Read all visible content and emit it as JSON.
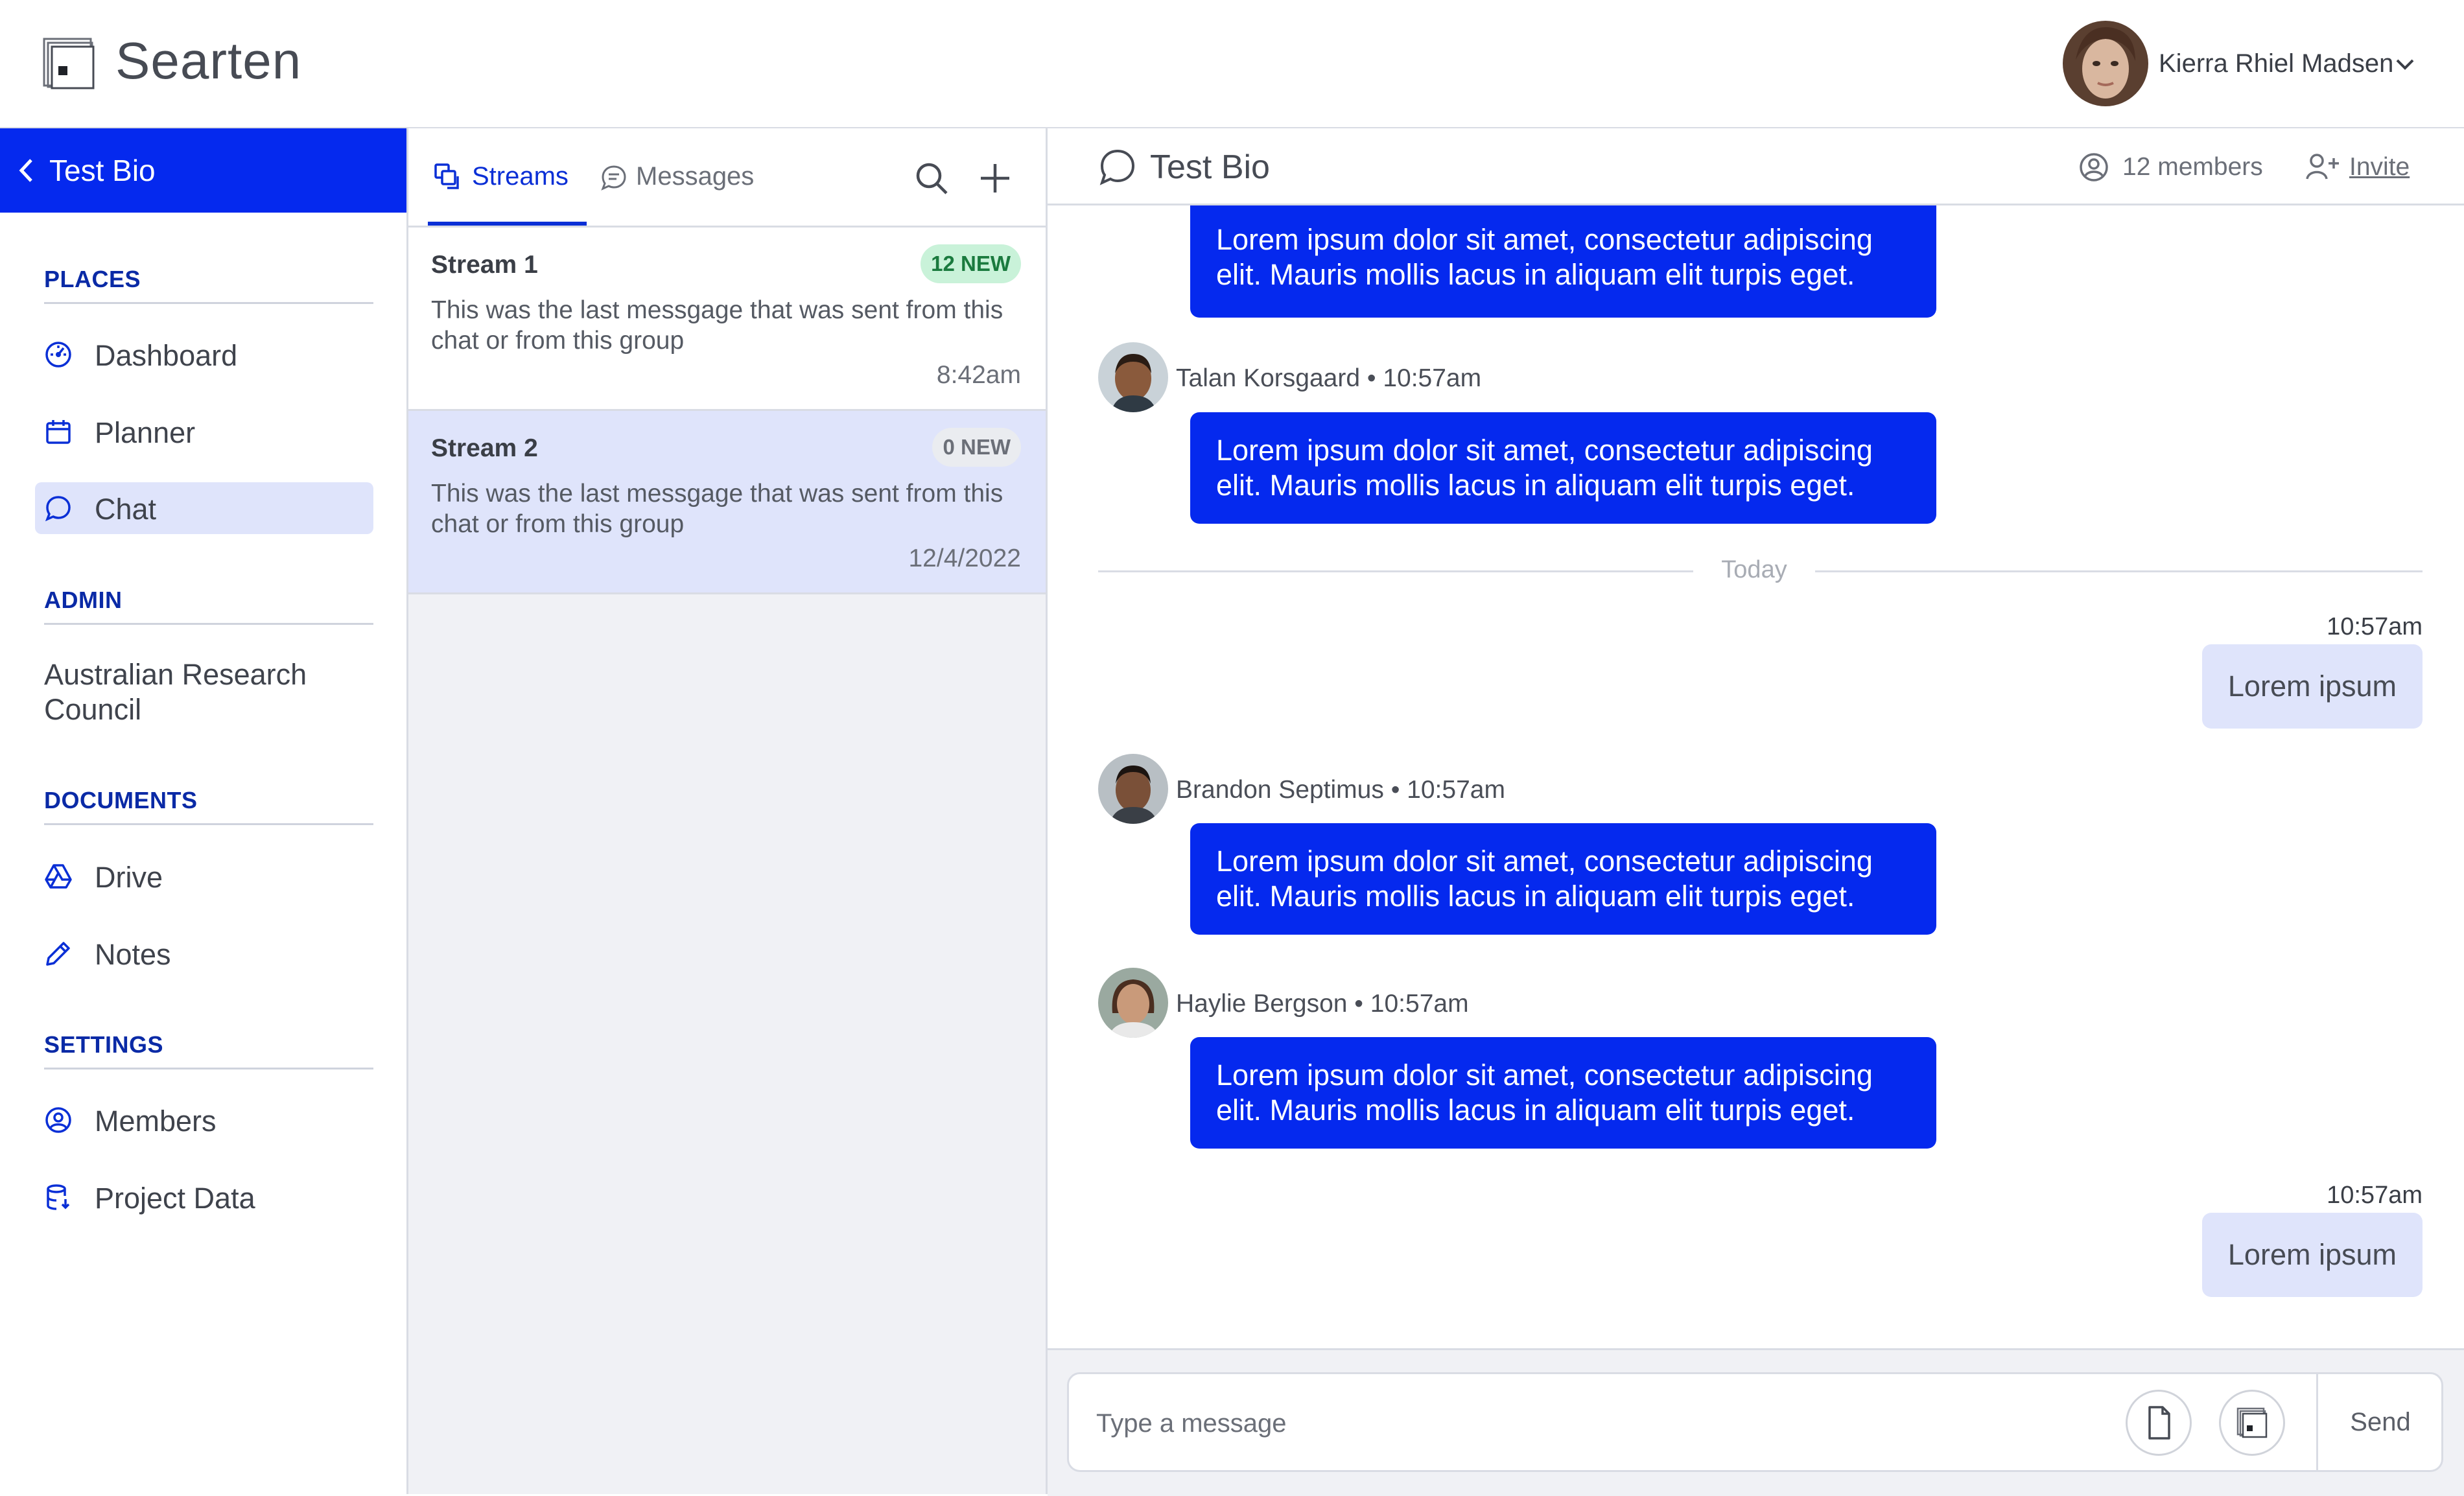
{
  "app": {
    "name": "Searten"
  },
  "user": {
    "name": "Kierra Rhiel Madsen"
  },
  "sidebar": {
    "project_title": "Test Bio",
    "sections": {
      "places": {
        "title": "PLACES",
        "items": [
          {
            "label": "Dashboard",
            "icon": "dashboard-icon"
          },
          {
            "label": "Planner",
            "icon": "calendar-icon"
          },
          {
            "label": "Chat",
            "icon": "chat-bubble-icon",
            "active": true
          }
        ]
      },
      "admin": {
        "title": "ADMIN",
        "org": "Australian Research Council"
      },
      "documents": {
        "title": "DOCUMENTS",
        "items": [
          {
            "label": "Drive",
            "icon": "drive-icon"
          },
          {
            "label": "Notes",
            "icon": "pencil-icon"
          }
        ]
      },
      "settings": {
        "title": "SETTINGS",
        "items": [
          {
            "label": "Members",
            "icon": "user-circle-icon"
          },
          {
            "label": "Project Data",
            "icon": "database-icon"
          }
        ]
      }
    }
  },
  "streams_panel": {
    "tabs": [
      {
        "label": "Streams",
        "active": true
      },
      {
        "label": "Messages",
        "active": false
      }
    ],
    "streams": [
      {
        "title": "Stream 1",
        "badge": "12 NEW",
        "preview": "This was the last messgage that was sent from this chat or from this group",
        "time": "8:42am",
        "selected": false
      },
      {
        "title": "Stream 2",
        "badge": "0 NEW",
        "preview": "This was the last messgage that was sent from this chat or from this group",
        "time": "12/4/2022",
        "selected": true
      }
    ]
  },
  "chat": {
    "title": "Test Bio",
    "members": "12 members",
    "invite": "Invite",
    "messages": {
      "m0": {
        "text": "Lorem ipsum dolor sit amet, consectetur adipiscing elit. Mauris mollis lacus in aliquam elit turpis eget."
      },
      "m1": {
        "sender": "Talan Korsgaard • 10:57am",
        "text": "Lorem ipsum dolor sit amet, consectetur adipiscing elit. Mauris mollis lacus in aliquam elit turpis eget."
      },
      "divider": "Today",
      "o1": {
        "time": "10:57am",
        "text": "Lorem ipsum"
      },
      "m2": {
        "sender": "Brandon Septimus • 10:57am",
        "text": "Lorem ipsum dolor sit amet, consectetur adipiscing elit. Mauris mollis lacus in aliquam elit turpis eget."
      },
      "m3": {
        "sender": "Haylie Bergson • 10:57am",
        "text": "Lorem ipsum dolor sit amet, consectetur adipiscing elit. Mauris mollis lacus in aliquam elit turpis eget."
      },
      "o2": {
        "time": "10:57am",
        "text": "Lorem ipsum"
      }
    },
    "composer": {
      "placeholder": "Type a message",
      "send_label": "Send"
    }
  },
  "colors": {
    "accent": "#0529ee",
    "selected_bg": "#dfe4fb",
    "badge_new_bg": "#c9f2d9",
    "badge_new_text": "#1a7a3e",
    "badge_zero_bg": "#eaecf0",
    "badge_zero_text": "#6b6f78"
  }
}
